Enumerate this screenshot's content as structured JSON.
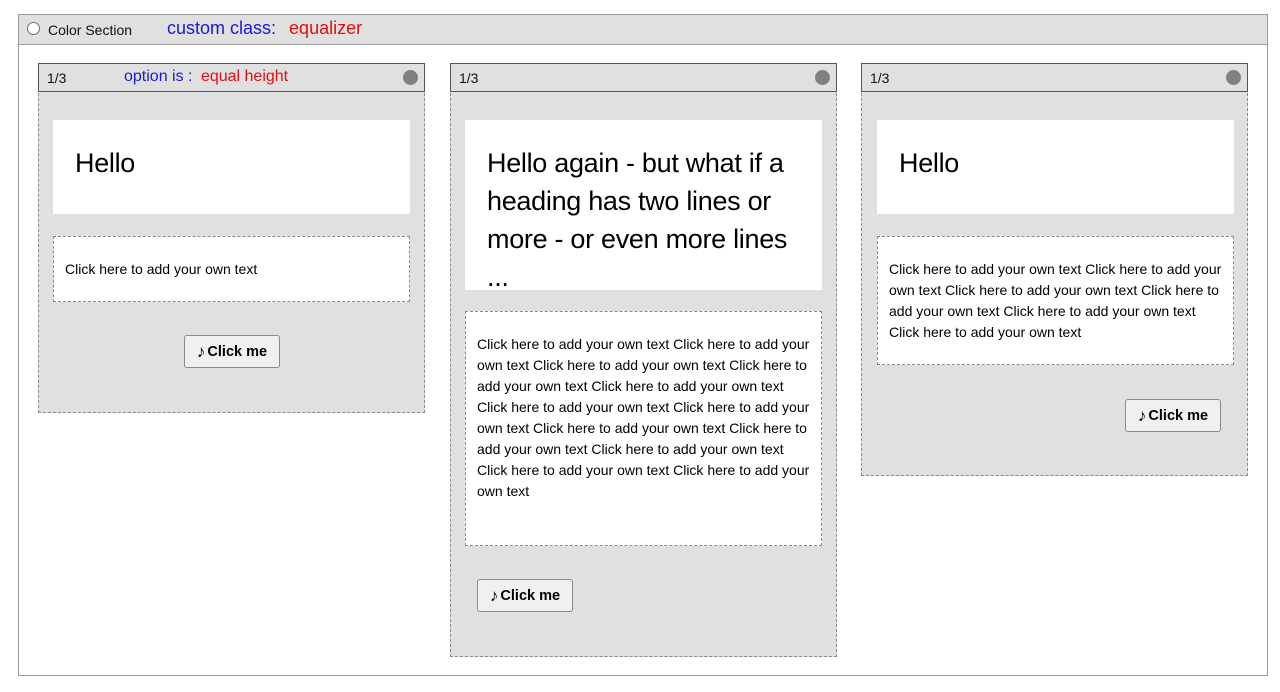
{
  "section": {
    "title": "Color Section",
    "annotation_label": "custom class:",
    "annotation_value": "equalizer"
  },
  "columns": [
    {
      "size": "1/3",
      "annotation_label": "option is :",
      "annotation_value": "equal height",
      "heading": "Hello",
      "text": "Click here to add your own text",
      "button_icon": "♪",
      "button_label": "Click me"
    },
    {
      "size": "1/3",
      "heading": "Hello again - but what if a heading has two lines or more - or even more lines ...",
      "text": "Click here to add your own text Click here to add your own text Click here to add your own text Click here to add your own text Click here to add your own text Click here to add your own text Click here to add your own text Click here to add your own text Click here to add your own text Click here to add your own text Click here to add your own text Click here to add your own text",
      "button_icon": "♪",
      "button_label": "Click me"
    },
    {
      "size": "1/3",
      "heading": "Hello",
      "text": "Click here to add your own text Click here to add your own text Click here to add your own text Click here to add your own text Click here to add your own text Click here to add your own text",
      "button_icon": "♪",
      "button_label": "Click me"
    }
  ]
}
